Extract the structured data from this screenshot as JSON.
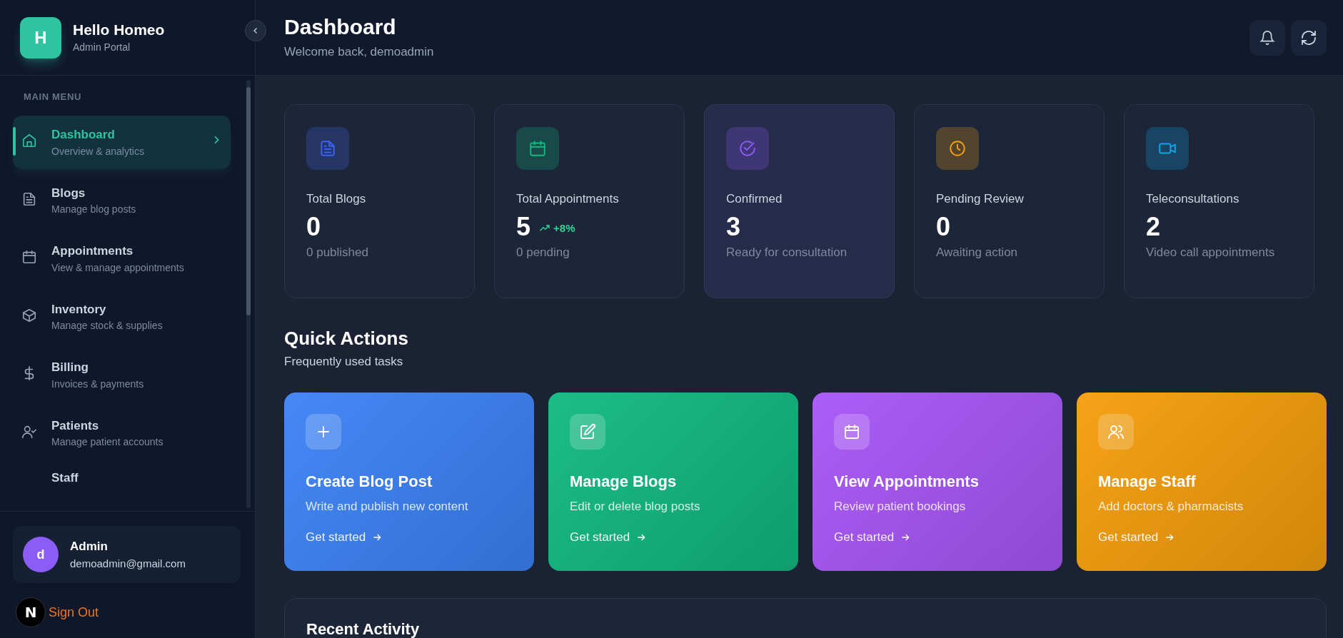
{
  "sidebar": {
    "brand": {
      "logo": "H",
      "title": "Hello Homeo",
      "subtitle": "Admin Portal"
    },
    "section_label": "MAIN MENU",
    "items": [
      {
        "title": "Dashboard",
        "subtitle": "Overview & analytics",
        "selected": true
      },
      {
        "title": "Blogs",
        "subtitle": "Manage blog posts",
        "selected": false
      },
      {
        "title": "Appointments",
        "subtitle": "View & manage appointments",
        "selected": false
      },
      {
        "title": "Inventory",
        "subtitle": "Manage stock & supplies",
        "selected": false
      },
      {
        "title": "Billing",
        "subtitle": "Invoices & payments",
        "selected": false
      },
      {
        "title": "Patients",
        "subtitle": "Manage patient accounts",
        "selected": false
      },
      {
        "title": "Staff",
        "selected": false
      }
    ],
    "user": {
      "avatar": "d",
      "name": "Admin",
      "email": "demoadmin@gmail.com"
    },
    "sign_out": "Sign Out"
  },
  "dev_badge": "N",
  "header": {
    "title": "Dashboard",
    "subtitle": "Welcome back, demoadmin"
  },
  "stats": [
    {
      "label": "Total Blogs",
      "value": "0",
      "note": "0 published",
      "color": "#3b63f0",
      "selected": false
    },
    {
      "label": "Total Appointments",
      "value": "5",
      "trend": "+8%",
      "note": "0 pending",
      "color": "#10b981",
      "selected": false
    },
    {
      "label": "Confirmed",
      "value": "3",
      "note": "Ready for consultation",
      "color": "#8b5cf6",
      "selected": true
    },
    {
      "label": "Pending Review",
      "value": "0",
      "note": "Awaiting action",
      "color": "#f59e0b",
      "selected": false
    },
    {
      "label": "Teleconsultations",
      "value": "2",
      "note": "Video call appointments",
      "color": "#0ea5e9",
      "selected": false
    }
  ],
  "quick_actions": {
    "title": "Quick Actions",
    "subtitle": "Frequently used tasks",
    "items": [
      {
        "title": "Create Blog Post",
        "description": "Write and publish new content",
        "link": "Get started",
        "color": "#3b82f6"
      },
      {
        "title": "Manage Blogs",
        "description": "Edit or delete blog posts",
        "link": "Get started",
        "color": "#10b981"
      },
      {
        "title": "View Appointments",
        "description": "Review patient bookings",
        "link": "Get started",
        "color": "#a855f7"
      },
      {
        "title": "Manage Staff",
        "description": "Add doctors & pharmacists",
        "link": "Get started",
        "color": "#f59e0b"
      }
    ]
  },
  "recent_activity": {
    "title": "Recent Activity"
  }
}
